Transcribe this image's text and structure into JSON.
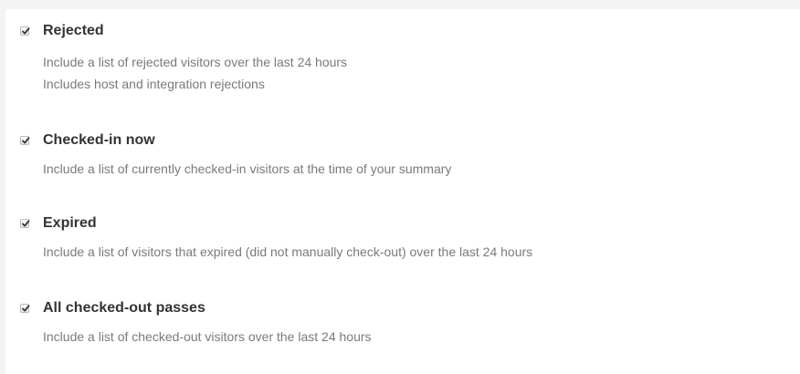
{
  "options": [
    {
      "title": "Rejected",
      "checked": true,
      "descriptions": [
        "Include a list of rejected visitors over the last 24 hours",
        "Includes host and integration rejections"
      ]
    },
    {
      "title": "Checked-in now",
      "checked": true,
      "descriptions": [
        "Include a list of currently checked-in visitors at the time of your summary"
      ]
    },
    {
      "title": "Expired",
      "checked": true,
      "descriptions": [
        "Include a list of visitors that expired (did not manually check-out) over the last 24 hours"
      ]
    },
    {
      "title": "All checked-out passes",
      "checked": true,
      "descriptions": [
        "Include a list of checked-out visitors over the last 24 hours"
      ]
    }
  ]
}
